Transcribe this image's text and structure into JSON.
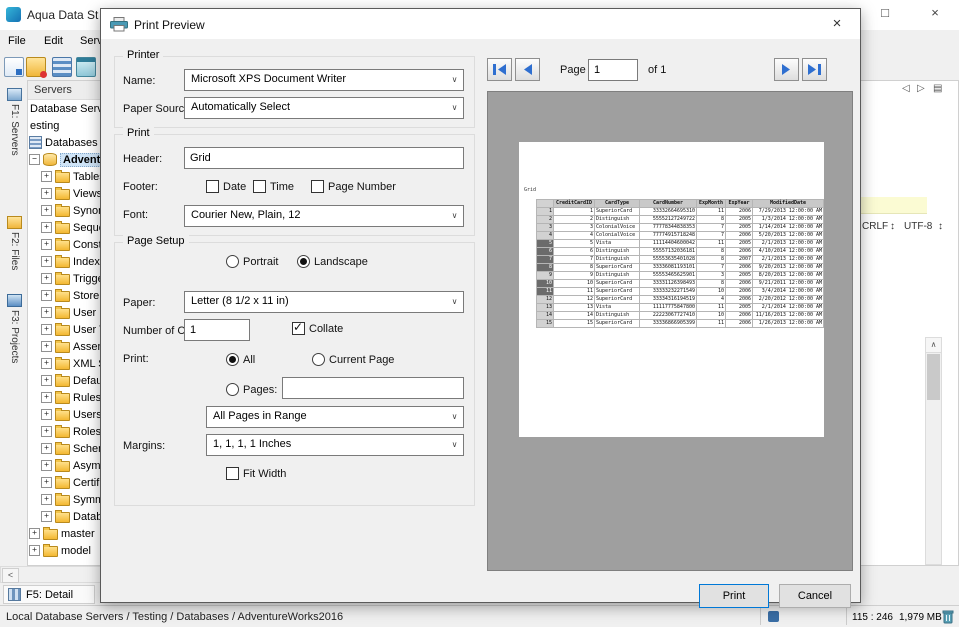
{
  "app": {
    "window_title": "Aqua Data St",
    "menu": [
      "File",
      "Edit",
      "Serv"
    ],
    "window_controls": {
      "maximize": "□",
      "close": "×"
    },
    "side_tabs": [
      {
        "label": "F1: Servers"
      },
      {
        "label": "F2: Files"
      },
      {
        "label": "F3: Projects"
      }
    ],
    "servers_panel": {
      "header": "Servers",
      "row_database_server": "Database Serve",
      "row_testing": "esting",
      "row_databases": "Databases",
      "selected_database": "AdventureW",
      "children": [
        "Tables",
        "Views",
        "Synon",
        "Seque",
        "Const",
        "Index",
        "Trigge",
        "Store",
        "User D",
        "User T",
        "Assem",
        "XML S",
        "Defau",
        "Rules",
        "Users",
        "Roles",
        "Schem",
        "Asym",
        "Certif",
        "Symm",
        "Datab"
      ],
      "sibling_databases": [
        "master",
        "model"
      ],
      "hscroll_arrow": "<"
    },
    "detail_tab": "F5: Detail",
    "editor": {
      "nav_back": "◁",
      "nav_forward": "▷",
      "doc_icon": "▤",
      "line_ending": "CRLF",
      "encoding": "UTF-8",
      "updown_arrow": "↕",
      "scroll_up": "∧"
    },
    "status": {
      "path": "Local Database Servers / Testing / Databases / AdventureWorks2016",
      "position": "115 : 246",
      "memory": "1,979 MB"
    }
  },
  "dialog": {
    "title": "Print Preview",
    "close": "×",
    "printer": {
      "legend": "Printer",
      "name_label": "Name:",
      "name_value": "Microsoft XPS Document Writer",
      "paper_source_label": "Paper Source:",
      "paper_source_value": "Automatically Select"
    },
    "print_group": {
      "legend": "Print",
      "header_label": "Header:",
      "header_value": "Grid",
      "footer_label": "Footer:",
      "footer_options": [
        {
          "label": "Date",
          "checked": false
        },
        {
          "label": "Time",
          "checked": false
        },
        {
          "label": "Page Number",
          "checked": false
        }
      ],
      "font_label": "Font:",
      "font_value": "Courier New, Plain, 12"
    },
    "page_setup": {
      "legend": "Page Setup",
      "portrait_label": "Portrait",
      "landscape_label": "Landscape",
      "orientation_selected": "Landscape",
      "paper_label": "Paper:",
      "paper_value": "Letter (8 1/2 x 11 in)",
      "copies_label": "Number of Copies:",
      "copies_value": "1",
      "collate_label": "Collate",
      "collate_checked": true,
      "print_label": "Print:",
      "all_label": "All",
      "current_page_label": "Current Page",
      "print_selected": "All",
      "pages_label": "Pages:",
      "pages_value": "",
      "pages_range_value": "All Pages in Range",
      "margins_label": "Margins:",
      "margins_value": "1, 1, 1, 1 Inches",
      "fit_width_label": "Fit Width",
      "fit_width_checked": false
    },
    "nav": {
      "page_label": "Page",
      "page_value": "1",
      "of_label": "of 1"
    },
    "preview": {
      "page_header": "Grid",
      "table": {
        "headers": [
          "CreditCardID",
          "CardType",
          "CardNumber",
          "ExpMonth",
          "ExpYear",
          "ModifiedDate"
        ],
        "rows": [
          [
            "1",
            "SuperiorCard",
            "33332664695310",
            "11",
            "2006",
            "7/29/2013 12:00:00 AM"
          ],
          [
            "2",
            "Distinguish",
            "55552127249722",
            "8",
            "2005",
            "1/3/2014 12:00:00 AM"
          ],
          [
            "3",
            "ColonialVoice",
            "77778344838353",
            "7",
            "2005",
            "1/14/2014 12:00:00 AM"
          ],
          [
            "4",
            "ColonialVoice",
            "77774915718248",
            "7",
            "2006",
            "5/20/2013 12:00:00 AM"
          ],
          [
            "5",
            "Vista",
            "11114404600042",
            "11",
            "2005",
            "2/1/2013 12:00:00 AM"
          ],
          [
            "6",
            "Distinguish",
            "55557132036181",
            "8",
            "2006",
            "4/10/2014 12:00:00 AM"
          ],
          [
            "7",
            "Distinguish",
            "55553635401028",
            "8",
            "2007",
            "2/1/2013 12:00:00 AM"
          ],
          [
            "8",
            "SuperiorCard",
            "33336081193101",
            "7",
            "2006",
            "9/20/2013 12:00:00 AM"
          ],
          [
            "9",
            "Distinguish",
            "55553465625901",
            "3",
            "2005",
            "8/20/2013 12:00:00 AM"
          ],
          [
            "10",
            "SuperiorCard",
            "33331126398493",
            "8",
            "2006",
            "9/21/2011 12:00:00 AM"
          ],
          [
            "11",
            "SuperiorCard",
            "33333232271549",
            "10",
            "2006",
            "3/4/2014 12:00:00 AM"
          ],
          [
            "12",
            "SuperiorCard",
            "33334316194519",
            "4",
            "2006",
            "2/20/2012 12:00:00 AM"
          ],
          [
            "13",
            "Vista",
            "11117775847800",
            "11",
            "2005",
            "2/1/2014 12:00:00 AM"
          ],
          [
            "14",
            "Distinguish",
            "22223067727410",
            "10",
            "2006",
            "11/16/2013 12:00:00 AM"
          ],
          [
            "15",
            "SuperiorCard",
            "33336866905399",
            "11",
            "2006",
            "1/26/2013 12:00:00 AM"
          ]
        ],
        "highlighted_rows": [
          5,
          6,
          7,
          8,
          10,
          11
        ]
      }
    },
    "buttons": {
      "print": "Print",
      "cancel": "Cancel"
    }
  },
  "colors": {
    "accent": "#0078d7",
    "arrow_blue": "#2f6fd0",
    "preview_bg": "#9f9f9f",
    "folder": "#f3b832"
  }
}
